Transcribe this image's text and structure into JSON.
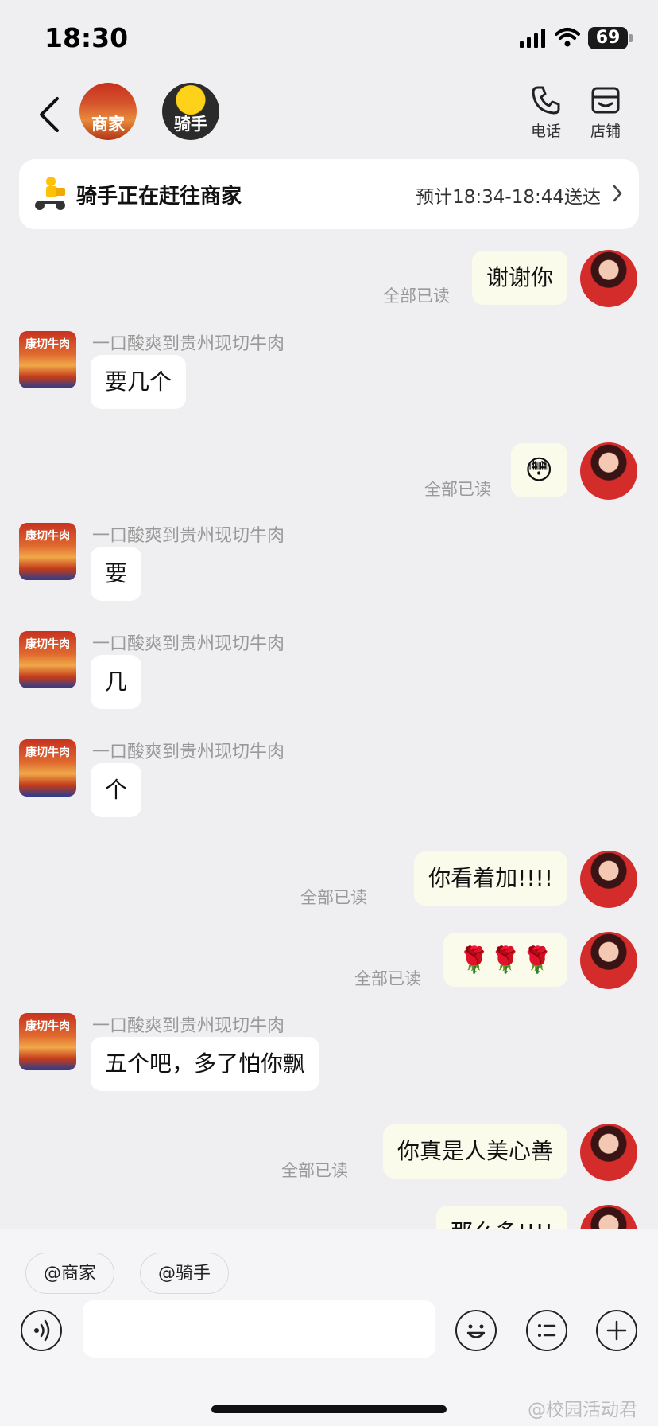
{
  "status_bar": {
    "time": "18:30",
    "battery": "69"
  },
  "header": {
    "merchant_tag": "商家",
    "rider_tag": "骑手",
    "call_label": "电话",
    "shop_label": "店铺"
  },
  "delivery": {
    "status": "骑手正在赶往商家",
    "eta": "预计18:34-18:44送达"
  },
  "merchant_avatar_text": "康切牛肉",
  "chat": {
    "merchant_name": "一口酸爽到贵州现切牛肉",
    "read_label": "全部已读",
    "messages": [
      {
        "side": "out",
        "text": "谢谢你"
      },
      {
        "side": "in",
        "text": "要几个"
      },
      {
        "side": "out",
        "text": "😳"
      },
      {
        "side": "in",
        "text": "要"
      },
      {
        "side": "in",
        "text": "几"
      },
      {
        "side": "in",
        "text": "个"
      },
      {
        "side": "out",
        "text": "你看着加!!!!"
      },
      {
        "side": "out",
        "text": "🌹🌹🌹"
      },
      {
        "side": "in",
        "text": "五个吧，多了怕你飘"
      },
      {
        "side": "out",
        "text": "你真是人美心善"
      },
      {
        "side": "out",
        "text": "那么多!!!!"
      }
    ]
  },
  "bottom_bar": {
    "mention_merchant": "@商家",
    "mention_rider": "@骑手",
    "input_value": ""
  },
  "watermark": "@校园活动君"
}
